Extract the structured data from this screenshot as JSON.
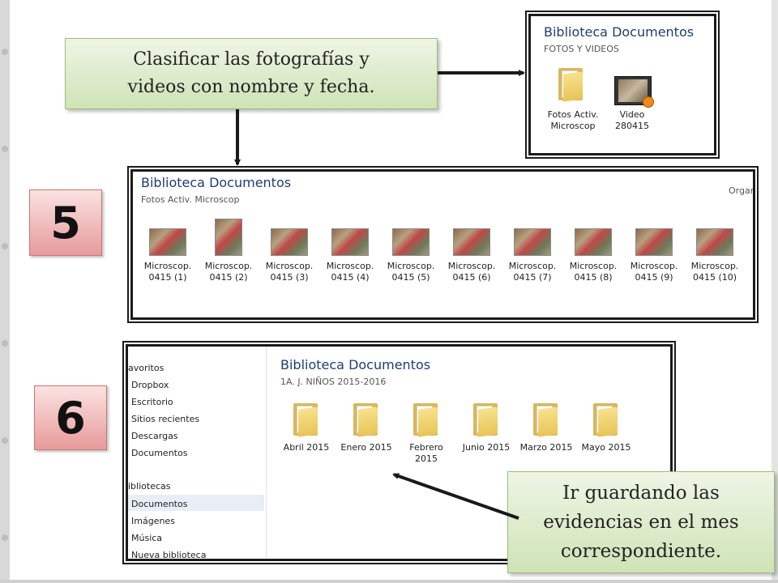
{
  "callouts": {
    "top": [
      "Clasificar las fotografías y",
      "videos con nombre y fecha."
    ],
    "bottom": [
      "Ir guardando las",
      "evidencias en el mes",
      "correspondiente."
    ]
  },
  "badges": {
    "five": "5",
    "six": "6"
  },
  "window1": {
    "title": "Biblioteca Documentos",
    "subtitle": "FOTOS Y VIDEOS",
    "items": [
      {
        "line1": "Fotos Activ.",
        "line2": "Microscop",
        "icon": "folder-icon"
      },
      {
        "line1": "Video",
        "line2": "280415",
        "icon": "video-icon"
      }
    ]
  },
  "window2": {
    "title": "Biblioteca Documentos",
    "subtitle": "Fotos Activ. Microscop",
    "organize": "Organ",
    "items": [
      {
        "line1": "Microscop.",
        "line2": "0415 (1)"
      },
      {
        "line1": "Microscop.",
        "line2": "0415 (2)"
      },
      {
        "line1": "Microscop.",
        "line2": "0415 (3)"
      },
      {
        "line1": "Microscop.",
        "line2": "0415 (4)"
      },
      {
        "line1": "Microscop.",
        "line2": "0415 (5)"
      },
      {
        "line1": "Microscop.",
        "line2": "0415 (6)"
      },
      {
        "line1": "Microscop.",
        "line2": "0415 (7)"
      },
      {
        "line1": "Microscop.",
        "line2": "0415 (8)"
      },
      {
        "line1": "Microscop.",
        "line2": "0415 (9)"
      },
      {
        "line1": "Microscop.",
        "line2": "0415 (10)"
      }
    ]
  },
  "window3": {
    "title": "Biblioteca Documentos",
    "subtitle": "1A. J. NIÑOS 2015-2016",
    "sidebar": {
      "favorites_head": "avoritos",
      "favorites": [
        "Dropbox",
        "Escritorio",
        "Sitios recientes",
        "Descargas",
        "Documentos"
      ],
      "libraries_head": "ibliotecas",
      "libraries": [
        "Documentos",
        "Imágenes",
        "Música",
        "Nueva biblioteca"
      ]
    },
    "folders": [
      {
        "line1": "Abril 2015",
        "line2": ""
      },
      {
        "line1": "Enero 2015",
        "line2": ""
      },
      {
        "line1": "Febrero",
        "line2": "2015"
      },
      {
        "line1": "Junio 2015",
        "line2": ""
      },
      {
        "line1": "Marzo 2015",
        "line2": ""
      },
      {
        "line1": "Mayo 2015",
        "line2": ""
      }
    ]
  }
}
